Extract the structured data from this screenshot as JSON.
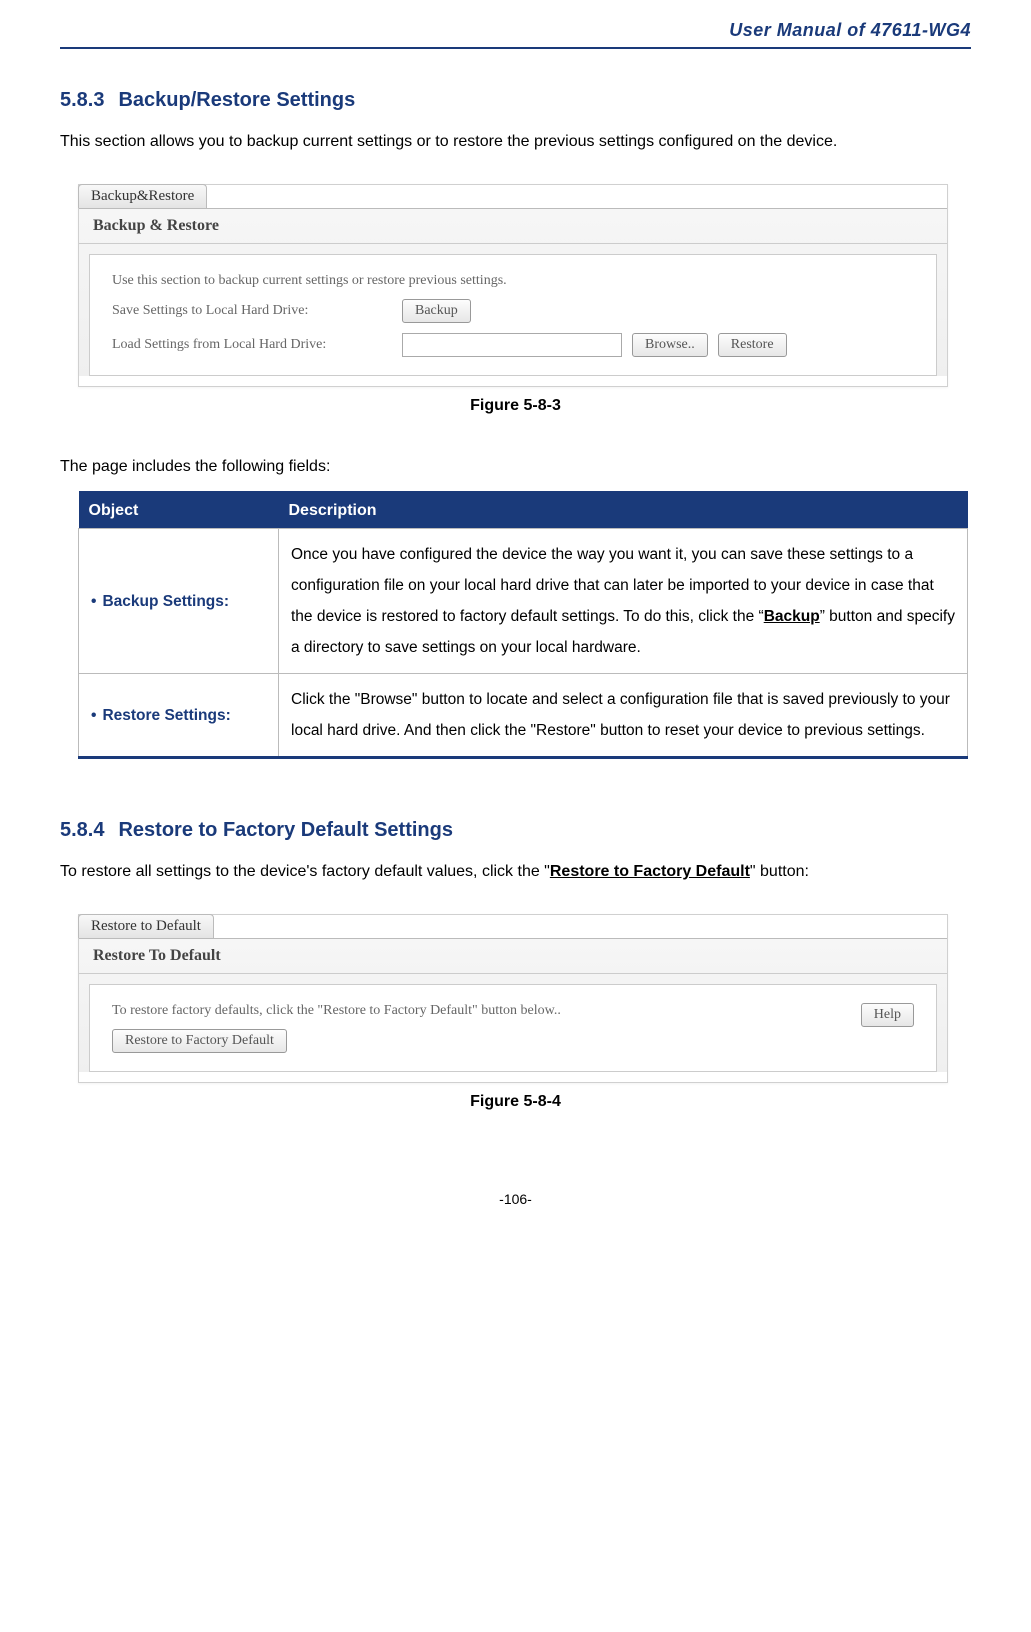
{
  "header": {
    "manual_title": "User Manual of 47611-WG4"
  },
  "section583": {
    "number": "5.8.3",
    "title": "Backup/Restore Settings",
    "intro": "This section allows you to backup current settings or to restore the previous settings configured on the device.",
    "figure_caption": "Figure 5-8-3",
    "fields_intro": "The page includes the following fields:"
  },
  "panel1": {
    "tab": "Backup&Restore",
    "title": "Backup & Restore",
    "desc": "Use this section to backup current settings or restore previous settings.",
    "row1_label": "Save Settings to Local Hard Drive:",
    "backup_btn": "Backup",
    "row2_label": "Load Settings from Local Hard Drive:",
    "browse_btn": "Browse..",
    "restore_btn": "Restore"
  },
  "table": {
    "h_object": "Object",
    "h_desc": "Description",
    "rows": [
      {
        "object": "Backup Settings:",
        "desc_pre": "Once you have configured the device the way you want it, you can save these settings to a configuration file on your local hard drive that can later be imported to your device in case that the device is restored to factory default settings.\nTo do this, click the “",
        "desc_bold": "Backup",
        "desc_post": "” button and specify a directory to save settings on your local hardware."
      },
      {
        "object": "Restore Settings:",
        "desc_pre": "Click the \"Browse\" button to locate and select a configuration file that is saved previously to your local hard drive. And then click the \"Restore\" button to reset your device to previous settings.",
        "desc_bold": "",
        "desc_post": ""
      }
    ]
  },
  "section584": {
    "number": "5.8.4",
    "title": "Restore to Factory Default Settings",
    "intro_pre": "To restore all settings to the device's factory default values, click the \"",
    "intro_bold": "Restore to Factory Default",
    "intro_post": "\" button:",
    "figure_caption": "Figure 5-8-4"
  },
  "panel2": {
    "tab": "Restore to Default",
    "title": "Restore To Default",
    "desc": "To restore factory defaults, click the \"Restore to Factory Default\" button below..",
    "help_btn": "Help",
    "restore_btn": "Restore to Factory Default"
  },
  "footer": {
    "page": "-106-"
  }
}
